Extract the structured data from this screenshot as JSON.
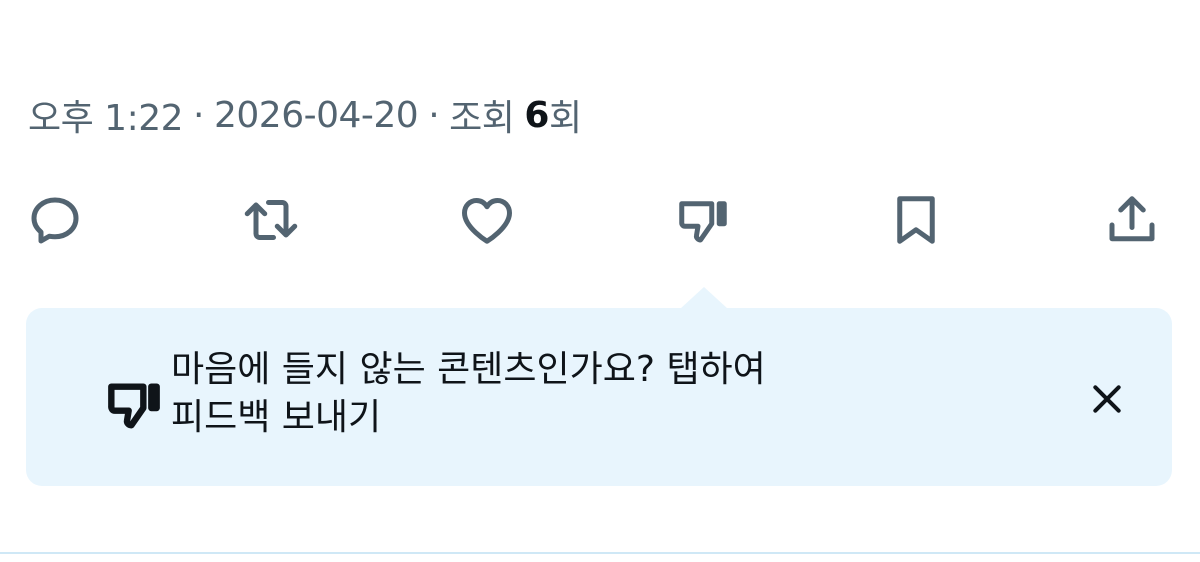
{
  "meta": {
    "time": "오후 1:22",
    "separator": "·",
    "date": "2026-04-20",
    "views_label": "조회",
    "views_count": "6",
    "views_suffix": "회"
  },
  "actions": [
    {
      "name": "reply",
      "icon": "speech-bubble-icon"
    },
    {
      "name": "repost",
      "icon": "repost-icon"
    },
    {
      "name": "like",
      "icon": "heart-icon"
    },
    {
      "name": "dislike",
      "icon": "thumbs-down-icon"
    },
    {
      "name": "bookmark",
      "icon": "bookmark-icon"
    },
    {
      "name": "share",
      "icon": "share-icon"
    }
  ],
  "feedback_callout": {
    "text_line1": "마음에 들지 않는 콘텐츠인가요? 탭하여",
    "text_line2": "피드백 보내기",
    "icon": "thumbs-down-icon",
    "close_icon": "close-icon"
  },
  "colors": {
    "icon": "#536471",
    "text_primary": "#0f1419",
    "text_secondary": "#536471",
    "callout_bg": "#e8f5fd",
    "divider": "#cfe8f6"
  }
}
